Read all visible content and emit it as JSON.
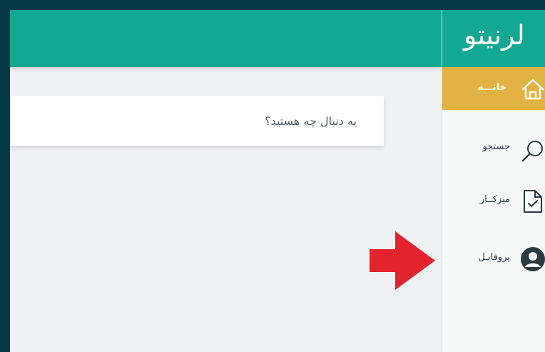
{
  "app": {
    "brand": "لرنیتو"
  },
  "search": {
    "placeholder": "به دنبال چه هستید؟"
  },
  "sidebar": {
    "items": [
      {
        "label": "خانـــه",
        "icon": "home-icon",
        "active": true
      },
      {
        "label": "جستجو",
        "icon": "search-icon",
        "active": false
      },
      {
        "label": "میزکــار",
        "icon": "document-check-icon",
        "active": false
      },
      {
        "label": "پروفایـل",
        "icon": "user-circle-icon",
        "active": false
      }
    ]
  },
  "annotation": {
    "icon": "red-arrow-icon",
    "color": "#e3242f"
  },
  "colors": {
    "frame": "#073848",
    "teal": "#13a891",
    "active": "#e3b245",
    "background": "#f0f1f3"
  }
}
